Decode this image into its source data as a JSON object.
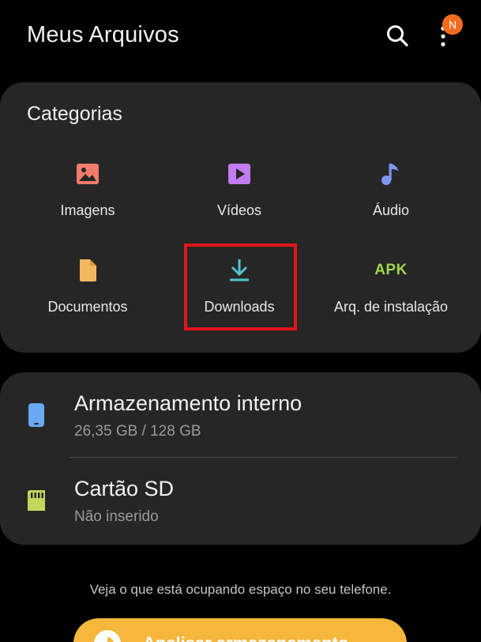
{
  "header": {
    "title": "Meus Arquivos",
    "search_icon": "search-icon",
    "more_icon": "more-vertical-icon",
    "notification_badge": "N",
    "badge_color": "#f26b1d"
  },
  "categories": {
    "title": "Categorias",
    "items": [
      {
        "label": "Imagens",
        "icon": "image-icon",
        "color": "#f27c6c"
      },
      {
        "label": "Vídeos",
        "icon": "video-icon",
        "color": "#c27cf0"
      },
      {
        "label": "Áudio",
        "icon": "music-note-icon",
        "color": "#7d96f2"
      },
      {
        "label": "Documentos",
        "icon": "document-icon",
        "color": "#f5b862"
      },
      {
        "label": "Downloads",
        "icon": "download-icon",
        "color": "#4ec6d1"
      },
      {
        "label": "Arq. de instalação",
        "icon": "apk-icon",
        "icon_text": "APK",
        "color": "#9dd64a"
      }
    ]
  },
  "storage": {
    "items": [
      {
        "name": "Armazenamento interno",
        "detail": "26,35 GB / 128 GB",
        "icon": "phone-icon",
        "color": "#6aa8f0"
      },
      {
        "name": "Cartão SD",
        "detail": "Não inserido",
        "icon": "sd-card-icon",
        "color": "#c4d65a"
      }
    ]
  },
  "footer": {
    "hint": "Veja o que está ocupando espaço no seu telefone.",
    "button_label": "Analisar armazenamento",
    "button_color": "#f6b73c"
  }
}
